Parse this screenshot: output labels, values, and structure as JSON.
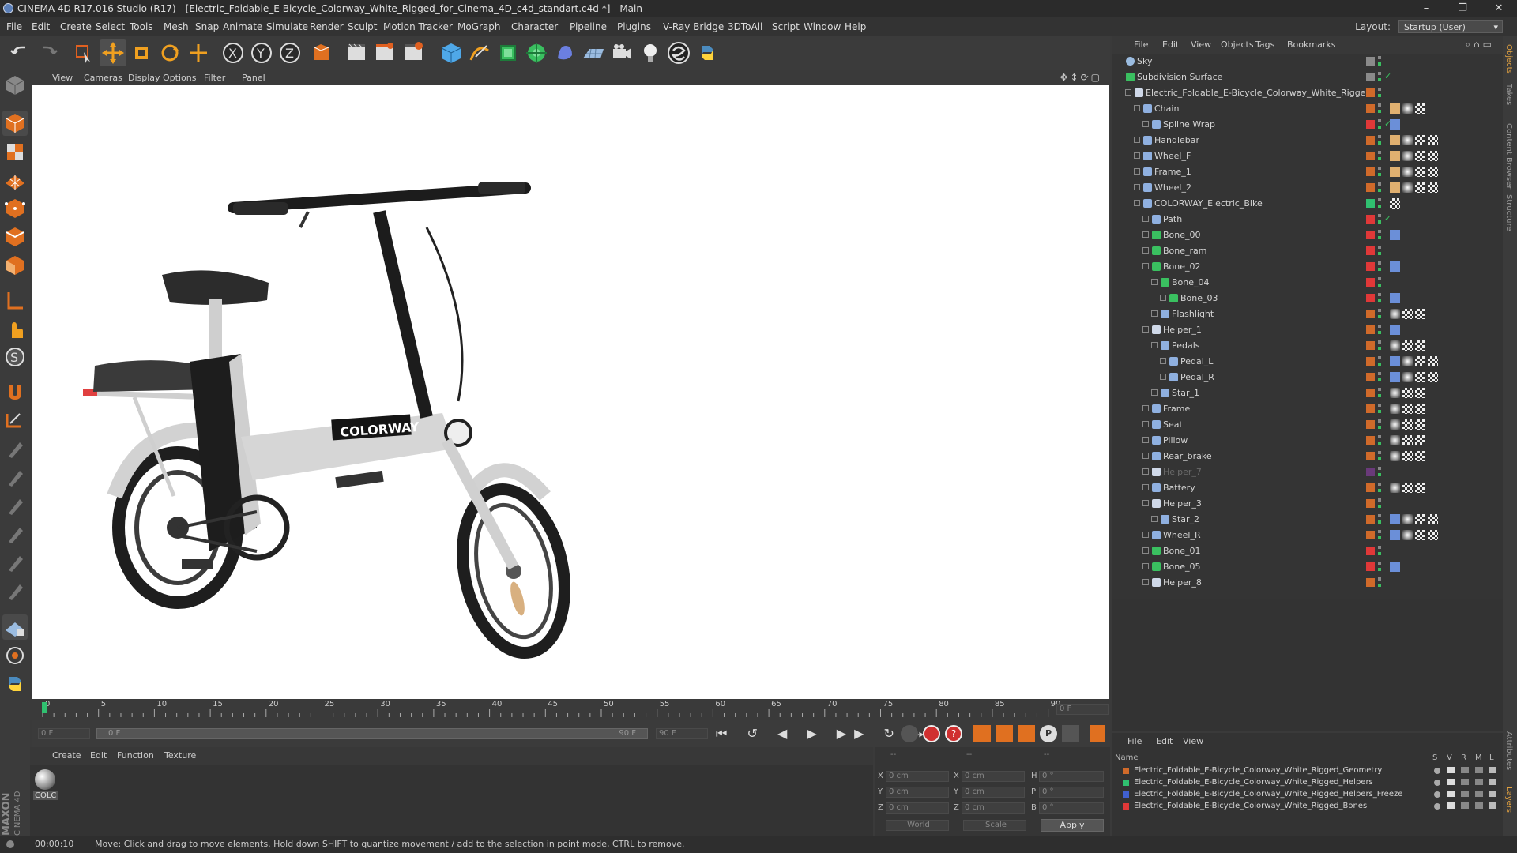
{
  "window": {
    "title": "CINEMA 4D R17.016 Studio (R17) - [Electric_Foldable_E-Bicycle_Colorway_White_Rigged_for_Cinema_4D_c4d_standart.c4d *] - Main",
    "minimize": "–",
    "restore": "❐",
    "close": "✕"
  },
  "menubar": {
    "items": [
      "File",
      "Edit",
      "Create",
      "Select",
      "Tools",
      "Mesh",
      "Snap",
      "Animate",
      "Simulate",
      "Render",
      "Sculpt",
      "Motion Tracker",
      "MoGraph",
      "Character",
      "Pipeline",
      "Plugins",
      "V-Ray Bridge",
      "3DToAll",
      "Script",
      "Window",
      "Help"
    ],
    "layout_label": "Layout:",
    "layout_value": "Startup (User)"
  },
  "viewport": {
    "menu": [
      "View",
      "Cameras",
      "Display",
      "Options",
      "Filter",
      "Panel"
    ],
    "brand_text": "COLORWAY"
  },
  "timeline": {
    "ticks": [
      "0",
      "5",
      "10",
      "15",
      "20",
      "25",
      "30",
      "35",
      "40",
      "45",
      "50",
      "55",
      "60",
      "65",
      "70",
      "75",
      "80",
      "85",
      "90"
    ],
    "end_field": "0 F"
  },
  "transport": {
    "start_field": "0 F",
    "slider_left": "0 F",
    "slider_right": "90 F",
    "end_field": "90 F"
  },
  "material": {
    "menu": [
      "Create",
      "Edit",
      "Function",
      "Texture"
    ],
    "swatch_label": "COLC"
  },
  "coords": {
    "header_left": "--",
    "header_mid": "--",
    "header_right": "--",
    "rows": [
      {
        "a": "X",
        "av": "0 cm",
        "b": "X",
        "bv": "0 cm",
        "c": "H",
        "cv": "0 °"
      },
      {
        "a": "Y",
        "av": "0 cm",
        "b": "Y",
        "bv": "0 cm",
        "c": "P",
        "cv": "0 °"
      },
      {
        "a": "Z",
        "av": "0 cm",
        "b": "Z",
        "bv": "0 cm",
        "c": "B",
        "cv": "0 °"
      }
    ],
    "world": "World",
    "scale": "Scale",
    "apply": "Apply"
  },
  "status": {
    "time": "00:00:10",
    "message": "Move: Click and drag to move elements. Hold down SHIFT to quantize movement / add to the selection in point mode, CTRL to remove."
  },
  "objects": {
    "menu": [
      "File",
      "Edit",
      "View",
      "Objects",
      "Tags",
      "Bookmarks"
    ],
    "rows": [
      {
        "name": "Sky",
        "indent": 0,
        "color": "#8a8a8a",
        "icon": "sky"
      },
      {
        "name": "Subdivision Surface",
        "indent": 0,
        "color": "#8a8a8a",
        "icon": "subdiv"
      },
      {
        "name": "Electric_Foldable_E-Bicycle_Colorway_White_Rigged",
        "indent": 1,
        "color": "#d06a2a",
        "icon": "null"
      },
      {
        "name": "Chain",
        "indent": 2,
        "color": "#d06a2a",
        "icon": "joint"
      },
      {
        "name": "Spline Wrap",
        "indent": 3,
        "color": "#e03838",
        "icon": "spline"
      },
      {
        "name": "Handlebar",
        "indent": 2,
        "color": "#d06a2a",
        "icon": "joint"
      },
      {
        "name": "Wheel_F",
        "indent": 2,
        "color": "#d06a2a",
        "icon": "joint"
      },
      {
        "name": "Frame_1",
        "indent": 2,
        "color": "#d06a2a",
        "icon": "joint"
      },
      {
        "name": "Wheel_2",
        "indent": 2,
        "color": "#d06a2a",
        "icon": "joint"
      },
      {
        "name": "COLORWAY_Electric_Bike",
        "indent": 2,
        "color": "#30c070",
        "icon": "joint"
      },
      {
        "name": "Path",
        "indent": 3,
        "color": "#e03838",
        "icon": "spline"
      },
      {
        "name": "Bone_00",
        "indent": 3,
        "color": "#e03838",
        "icon": "bone"
      },
      {
        "name": "Bone_ram",
        "indent": 3,
        "color": "#e03838",
        "icon": "bone"
      },
      {
        "name": "Bone_02",
        "indent": 3,
        "color": "#e03838",
        "icon": "bone"
      },
      {
        "name": "Bone_04",
        "indent": 4,
        "color": "#e03838",
        "icon": "bone"
      },
      {
        "name": "Bone_03",
        "indent": 5,
        "color": "#e03838",
        "icon": "bone"
      },
      {
        "name": "Flashlight",
        "indent": 4,
        "color": "#d06a2a",
        "icon": "joint"
      },
      {
        "name": "Helper_1",
        "indent": 3,
        "color": "#d06a2a",
        "icon": "null"
      },
      {
        "name": "Pedals",
        "indent": 4,
        "color": "#d06a2a",
        "icon": "joint"
      },
      {
        "name": "Pedal_L",
        "indent": 5,
        "color": "#d06a2a",
        "icon": "joint"
      },
      {
        "name": "Pedal_R",
        "indent": 5,
        "color": "#d06a2a",
        "icon": "joint"
      },
      {
        "name": "Star_1",
        "indent": 4,
        "color": "#d06a2a",
        "icon": "joint"
      },
      {
        "name": "Frame",
        "indent": 3,
        "color": "#d06a2a",
        "icon": "joint"
      },
      {
        "name": "Seat",
        "indent": 3,
        "color": "#d06a2a",
        "icon": "joint"
      },
      {
        "name": "Pillow",
        "indent": 3,
        "color": "#d06a2a",
        "icon": "joint"
      },
      {
        "name": "Rear_brake",
        "indent": 3,
        "color": "#d06a2a",
        "icon": "joint"
      },
      {
        "name": "Helper_7",
        "indent": 3,
        "color": "#6a3a7a",
        "icon": "null"
      },
      {
        "name": "Battery",
        "indent": 3,
        "color": "#d06a2a",
        "icon": "joint"
      },
      {
        "name": "Helper_3",
        "indent": 3,
        "color": "#d06a2a",
        "icon": "null"
      },
      {
        "name": "Star_2",
        "indent": 4,
        "color": "#d06a2a",
        "icon": "joint"
      },
      {
        "name": "Wheel_R",
        "indent": 3,
        "color": "#d06a2a",
        "icon": "joint"
      },
      {
        "name": "Bone_01",
        "indent": 3,
        "color": "#e03838",
        "icon": "bone"
      },
      {
        "name": "Bone_05",
        "indent": 3,
        "color": "#e03838",
        "icon": "bone"
      },
      {
        "name": "Helper_8",
        "indent": 3,
        "color": "#d06a2a",
        "icon": "null"
      }
    ]
  },
  "layers": {
    "menu": [
      "File",
      "Edit",
      "View"
    ],
    "header_name": "Name",
    "header_cols": [
      "S",
      "V",
      "R",
      "M",
      "L"
    ],
    "rows": [
      {
        "name": "Electric_Foldable_E-Bicycle_Colorway_White_Rigged_Geometry",
        "color": "#d06a2a"
      },
      {
        "name": "Electric_Foldable_E-Bicycle_Colorway_White_Rigged_Helpers",
        "color": "#30c070"
      },
      {
        "name": "Electric_Foldable_E-Bicycle_Colorway_White_Rigged_Helpers_Freeze",
        "color": "#4060d0"
      },
      {
        "name": "Electric_Foldable_E-Bicycle_Colorway_White_Rigged_Bones",
        "color": "#e03838"
      }
    ]
  },
  "side_tabs": [
    "Objects",
    "Takes",
    "Content Browser",
    "Structure"
  ],
  "side_tabs_lower": [
    "Attributes",
    "Layers"
  ],
  "vendor": {
    "line1": "MAXON",
    "line2": "CINEMA 4D"
  }
}
